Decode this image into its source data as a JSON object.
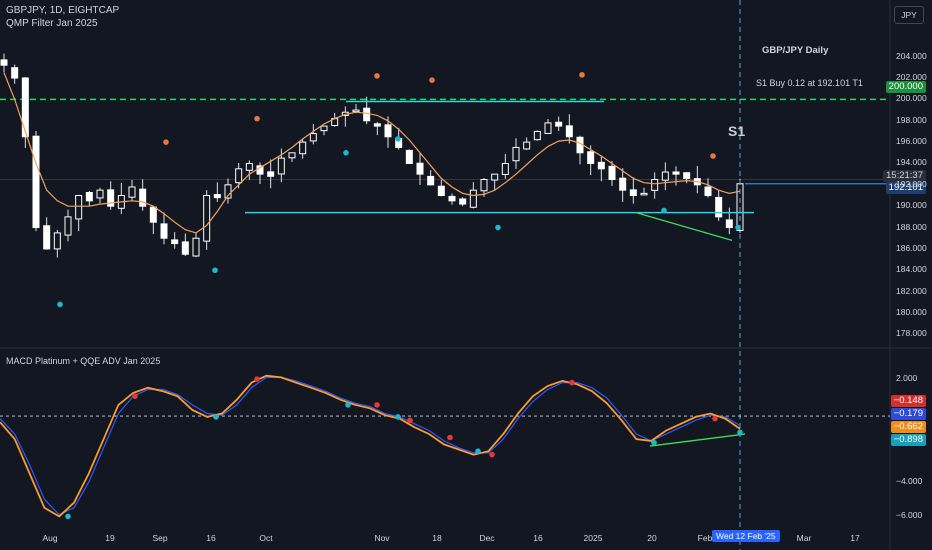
{
  "header": {
    "symbol_line": "GBPJPY, 1D, EIGHTCAP",
    "indicator_line": "QMP Filter Jan 2025",
    "osc_title": "MACD Platinum + QQE ADV Jan 2025",
    "currency_button": "JPY"
  },
  "annotations": {
    "chart_label": "GBP/JPY Daily",
    "signal_note": "S1 Buy 0.12 at 192.101 T1",
    "s1_marker": "S1"
  },
  "price_tags": {
    "countdown": "15:21:37",
    "last_price": "192.101",
    "target_level": "200.000"
  },
  "osc_tags": {
    "t1": "−0.148",
    "t2": "−0.179",
    "t3": "−0.662",
    "t4": "−0.898"
  },
  "cursor_date": "Wed 12 Feb '25",
  "colors": {
    "background": "#131722",
    "up_candle": "#ffffff",
    "down_candle": "#ffffff",
    "ma_line": "#f0a35e",
    "support": "#29d4e6",
    "trendline": "#3ddc5a",
    "target_line": "#22dd55",
    "dot_sell": "#e8773c",
    "dot_buy": "#19b8d1",
    "macd": "#ff9a2e",
    "signal": "#2a5cff",
    "cursor": "#4fa9e8"
  },
  "chart_data": [
    {
      "type": "candlestick",
      "title": "GBP/JPY Daily",
      "y_axis": {
        "ticks": [
          204.0,
          202.0,
          200.0,
          198.0,
          196.0,
          194.0,
          192.0,
          190.0,
          188.0,
          186.0,
          184.0,
          182.0,
          180.0,
          178.0
        ],
        "tick_labels": [
          "204.000",
          "202.000",
          "200.000",
          "198.000",
          "196.000",
          "194.000",
          "192.000",
          "190.000",
          "188.000",
          "186.000",
          "184.000",
          "182.000",
          "180.000",
          "178.000"
        ],
        "ylim": [
          177.0,
          206.5
        ]
      },
      "x_axis": {
        "tick_labels": [
          "Aug",
          "19",
          "Sep",
          "16",
          "Oct",
          "Nov",
          "18",
          "Dec",
          "16",
          "2025",
          "20",
          "Feb",
          "Mar",
          "17"
        ]
      },
      "target_level": 200.0,
      "last_price": 192.101,
      "support_levels": [
        {
          "level": 199.8,
          "start": "Oct 28",
          "end": "Jan 6"
        },
        {
          "level": 189.4,
          "start": "Sep 25",
          "end": "Feb 12"
        }
      ],
      "close_series": {
        "name": "",
        "dates": [
          "Jul 31",
          "Aug 2",
          "Aug 5",
          "Aug 7",
          "Aug 9",
          "Aug 13",
          "Aug 15",
          "Aug 19",
          "Aug 21",
          "Aug 23",
          "Aug 27",
          "Aug 29",
          "Sep 2",
          "Sep 4",
          "Sep 6",
          "Sep 10",
          "Sep 12",
          "Sep 16",
          "Sep 18",
          "Sep 20",
          "Sep 24",
          "Sep 26",
          "Sep 30",
          "Oct 2",
          "Oct 4",
          "Oct 8",
          "Oct 10",
          "Oct 14",
          "Oct 16",
          "Oct 18",
          "Oct 22",
          "Oct 24",
          "Oct 28",
          "Oct 30",
          "Nov 1",
          "Nov 5",
          "Nov 7",
          "Nov 11",
          "Nov 13",
          "Nov 15",
          "Nov 19",
          "Nov 21",
          "Nov 25",
          "Nov 27",
          "Nov 29",
          "Dec 3",
          "Dec 5",
          "Dec 9",
          "Dec 11",
          "Dec 13",
          "Dec 17",
          "Dec 19",
          "Dec 23",
          "Dec 27",
          "Dec 31",
          "Jan 3",
          "Jan 7",
          "Jan 9",
          "Jan 13",
          "Jan 15",
          "Jan 17",
          "Jan 21",
          "Jan 23",
          "Jan 27",
          "Jan 29",
          "Jan 31",
          "Feb 4",
          "Feb 6",
          "Feb 10",
          "Feb 12"
        ],
        "values": [
          203.2,
          202.0,
          196.5,
          188.0,
          186.0,
          187.5,
          189.0,
          191.0,
          190.5,
          191.5,
          190.0,
          191.0,
          191.8,
          190.0,
          188.5,
          187.0,
          186.5,
          185.5,
          187.0,
          191.0,
          190.8,
          192.0,
          193.5,
          194.0,
          193.0,
          192.8,
          194.5,
          195.0,
          196.0,
          196.8,
          197.5,
          198.2,
          198.8,
          199.0,
          198.0,
          197.5,
          196.5,
          195.5,
          194.0,
          193.0,
          192.0,
          191.0,
          190.5,
          190.2,
          191.5,
          192.5,
          193.0,
          194.0,
          195.5,
          196.0,
          197.0,
          197.8,
          197.5,
          196.5,
          195.0,
          194.0,
          193.5,
          192.5,
          191.5,
          191.0,
          191.2,
          192.5,
          193.2,
          193.0,
          192.6,
          192.0,
          191.0,
          189.0,
          188.0,
          192.1
        ]
      },
      "ma_series": {
        "name": "",
        "values": [
          202.5,
          200.0,
          197.0,
          194.0,
          191.5,
          190.5,
          190.0,
          190.0,
          190.0,
          190.2,
          190.3,
          190.4,
          190.5,
          190.4,
          190.0,
          189.3,
          188.5,
          187.8,
          187.5,
          188.2,
          189.5,
          191.0,
          192.0,
          193.0,
          193.6,
          194.2,
          194.8,
          195.5,
          196.3,
          197.0,
          197.7,
          198.2,
          198.6,
          198.8,
          198.7,
          198.5,
          198.0,
          197.2,
          196.2,
          195.0,
          193.8,
          192.6,
          191.8,
          191.2,
          191.0,
          191.1,
          191.5,
          192.2,
          193.0,
          193.9,
          194.8,
          195.6,
          196.1,
          196.2,
          195.9,
          195.3,
          194.7,
          194.0,
          193.3,
          192.6,
          192.2,
          192.1,
          192.2,
          192.3,
          192.4,
          192.3,
          192.0,
          191.5,
          191.2,
          191.4
        ]
      },
      "sell_markers": [
        {
          "date": "Sep 12",
          "value": 195.5
        },
        {
          "date": "Nov 1",
          "value": 200.8
        },
        {
          "date": "Nov 12",
          "value": 200.6
        },
        {
          "date": "Jan 7",
          "value": 200.8
        },
        {
          "date": "Feb 3",
          "value": 194.7
        },
        {
          "date": "Aug 30",
          "value": 197.8
        }
      ],
      "buy_markers": [
        {
          "date": "Aug 8",
          "value": 180.8
        },
        {
          "date": "Sep 20",
          "value": 184.0
        },
        {
          "date": "Oct 31",
          "value": 195.0
        },
        {
          "date": "Nov 15",
          "value": 193.5
        },
        {
          "date": "Dec 3",
          "value": 188.0
        },
        {
          "date": "Jan 24",
          "value": 189.6
        },
        {
          "date": "Feb 13",
          "value": 188.0
        }
      ]
    },
    {
      "type": "line",
      "title": "MACD Platinum + QQE ADV Jan 2025",
      "y_axis": {
        "ticks": [
          2.0,
          0.0,
          -2.0,
          -4.0,
          -6.0
        ],
        "tick_labels": [
          "2.000",
          "",
          "",
          "−4.000",
          "−6.000"
        ],
        "ylim": [
          -6.5,
          3.0
        ]
      },
      "series": [
        {
          "name": "",
          "values": [
            -0.5,
            -1.5,
            -3.5,
            -5.5,
            -6.0,
            -5.2,
            -3.5,
            -1.5,
            0.5,
            1.2,
            1.5,
            1.3,
            1.0,
            0.2,
            -0.2,
            0.0,
            0.8,
            1.8,
            2.2,
            2.1,
            1.8,
            1.5,
            1.2,
            0.8,
            0.5,
            0.3,
            -0.1,
            -0.3,
            -0.8,
            -1.2,
            -1.8,
            -2.1,
            -2.4,
            -2.2,
            -1.2,
            0.0,
            1.0,
            1.6,
            1.9,
            1.7,
            1.3,
            0.6,
            -0.4,
            -1.5,
            -1.6,
            -1.0,
            -0.6,
            -0.2,
            0.0,
            -0.3,
            -0.9
          ]
        },
        {
          "name": "",
          "values": [
            -0.3,
            -1.2,
            -3.0,
            -5.0,
            -5.9,
            -5.5,
            -4.0,
            -2.0,
            0.0,
            1.0,
            1.4,
            1.4,
            1.1,
            0.5,
            0.0,
            -0.1,
            0.5,
            1.5,
            2.1,
            2.1,
            1.9,
            1.6,
            1.3,
            0.9,
            0.6,
            0.4,
            0.0,
            -0.2,
            -0.6,
            -1.0,
            -1.6,
            -2.0,
            -2.3,
            -2.3,
            -1.5,
            -0.3,
            0.7,
            1.4,
            1.8,
            1.8,
            1.5,
            0.9,
            -0.1,
            -1.2,
            -1.6,
            -1.2,
            -0.8,
            -0.4,
            -0.1,
            -0.2,
            -0.7
          ]
        }
      ],
      "last_values": [
        -0.148,
        -0.179,
        -0.662,
        -0.898
      ]
    }
  ]
}
